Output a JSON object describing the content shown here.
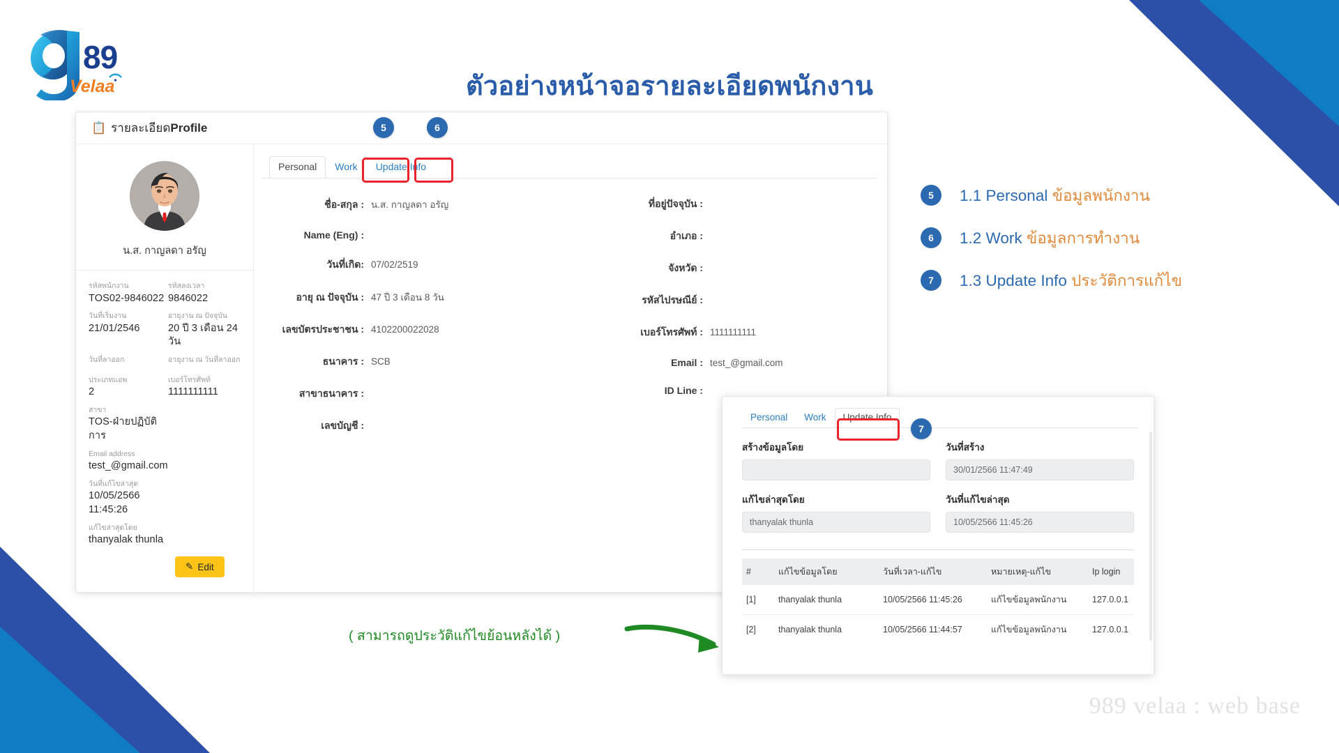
{
  "page": {
    "title": "ตัวอย่างหน้าจอรายละเอียดพนักงาน",
    "watermark": "989 velaa : web base",
    "accent_blue": "#2b69b0",
    "accent_orange": "#e08a3c",
    "highlight_red": "#e8242a",
    "green": "#1f8a23",
    "corner_dark_blue": "#2c4fa8",
    "corner_light_blue": "#0f7cc4"
  },
  "logo": {
    "nine": "9",
    "eightnine": "89",
    "wordmark": "Velaa"
  },
  "card": {
    "header_icon": "clipboard-icon",
    "header_th": "รายละเอียด ",
    "header_en": "Profile",
    "tabs": [
      {
        "label": "Personal",
        "active": true
      },
      {
        "label": "Work",
        "active": false
      },
      {
        "label": "Update Info",
        "active": false
      }
    ],
    "profile": {
      "avatar_alt": "user-avatar",
      "name": "น.ส. กาญลดา อรัญ"
    },
    "sidebar_fields": [
      {
        "label": "รหัสพนักงาน",
        "value": "TOS02-9846022"
      },
      {
        "label": "รหัสลงเวลา",
        "value": "9846022"
      },
      {
        "label": "วันที่เริ่มงาน",
        "value": "21/01/2546"
      },
      {
        "label": "อายุงาน ณ ปัจจุบัน",
        "value": "20 ปี 3 เดือน 24 วัน"
      },
      {
        "label": "วันที่ลาออก",
        "value": ""
      },
      {
        "label": "อายุงาน ณ วันที่ลาออก",
        "value": ""
      },
      {
        "label": "ประเภทแอพ",
        "value": "2"
      },
      {
        "label": "เบอร์โทรศัพท์",
        "value": "1111111111"
      },
      {
        "label": "สาขา",
        "value": "TOS-ฝ่ายปฏิบัติการ"
      },
      {
        "label": "Email address",
        "value": "test_@gmail.com"
      },
      {
        "label": "วันที่แก้ไขล่าสุด",
        "value": "10/05/2566 11:45:26"
      },
      {
        "label": "แก้ไขล่าสุดโดย",
        "value": "thanyalak thunla"
      }
    ],
    "edit_button": "Edit",
    "personal_left": [
      {
        "label": "ชื่อ-สกุล :",
        "value": "น.ส. กาญลดา อรัญ"
      },
      {
        "label": "Name (Eng) :",
        "value": ""
      },
      {
        "label": "วันที่เกิด:",
        "value": "07/02/2519"
      },
      {
        "label": "อายุ ณ ปัจจุบัน :",
        "value": "47 ปี 3 เดือน 8 วัน"
      },
      {
        "label": "เลขบัตรประชาชน :",
        "value": "4102200022028"
      },
      {
        "label": "ธนาคาร :",
        "value": "SCB"
      },
      {
        "label": "สาขาธนาคาร :",
        "value": ""
      },
      {
        "label": "เลขบัญชี :",
        "value": ""
      }
    ],
    "personal_right": [
      {
        "label": "ที่อยู่ปัจจุบัน :",
        "value": ""
      },
      {
        "label": "อำเภอ :",
        "value": ""
      },
      {
        "label": "จังหวัด :",
        "value": ""
      },
      {
        "label": "รหัสไปรษณีย์ :",
        "value": ""
      },
      {
        "label": "เบอร์โทรศัพท์ :",
        "value": "1111111111"
      },
      {
        "label": "Email :",
        "value": "test_@gmail.com"
      },
      {
        "label": "ID Line :",
        "value": ""
      }
    ]
  },
  "badges": {
    "five": "5",
    "six": "6",
    "seven": "7"
  },
  "legend": [
    {
      "num": "5",
      "en": "1.1 Personal ",
      "th": "ข้อมูลพนักงาน"
    },
    {
      "num": "6",
      "en": "1.2 Work ",
      "th": "ข้อมูลการทำงาน"
    },
    {
      "num": "7",
      "en": "1.3 Update Info ",
      "th": "ประวัติการแก้ไข"
    }
  ],
  "update_panel": {
    "tabs": [
      {
        "label": "Personal",
        "active": false
      },
      {
        "label": "Work",
        "active": false
      },
      {
        "label": "Update Info",
        "active": true
      }
    ],
    "fields": [
      {
        "label": "สร้างข้อมูลโดย",
        "value": ""
      },
      {
        "label": "วันที่สร้าง",
        "value": "30/01/2566 11:47:49"
      },
      {
        "label": "แก้ไขล่าสุดโดย",
        "value": "thanyalak thunla"
      },
      {
        "label": "วันที่แก้ไขล่าสุด",
        "value": "10/05/2566 11:45:26"
      }
    ],
    "table": {
      "headers": [
        "#",
        "แก้ไขข้อมูลโดย",
        "วันที่เวลา-แก้ไข",
        "หมายเหตุ-แก้ไข",
        "Ip login"
      ],
      "rows": [
        [
          "[1]",
          "thanyalak thunla",
          "10/05/2566 11:45:26",
          "แก้ไขข้อมูลพนักงาน",
          "127.0.0.1"
        ],
        [
          "[2]",
          "thanyalak thunla",
          "10/05/2566 11:44:57",
          "แก้ไขข้อมูลพนักงาน",
          "127.0.0.1"
        ]
      ]
    }
  },
  "annotation": {
    "green_note": "(  สามารถดูประวัติแก้ไขย้อนหลังได้  )"
  }
}
